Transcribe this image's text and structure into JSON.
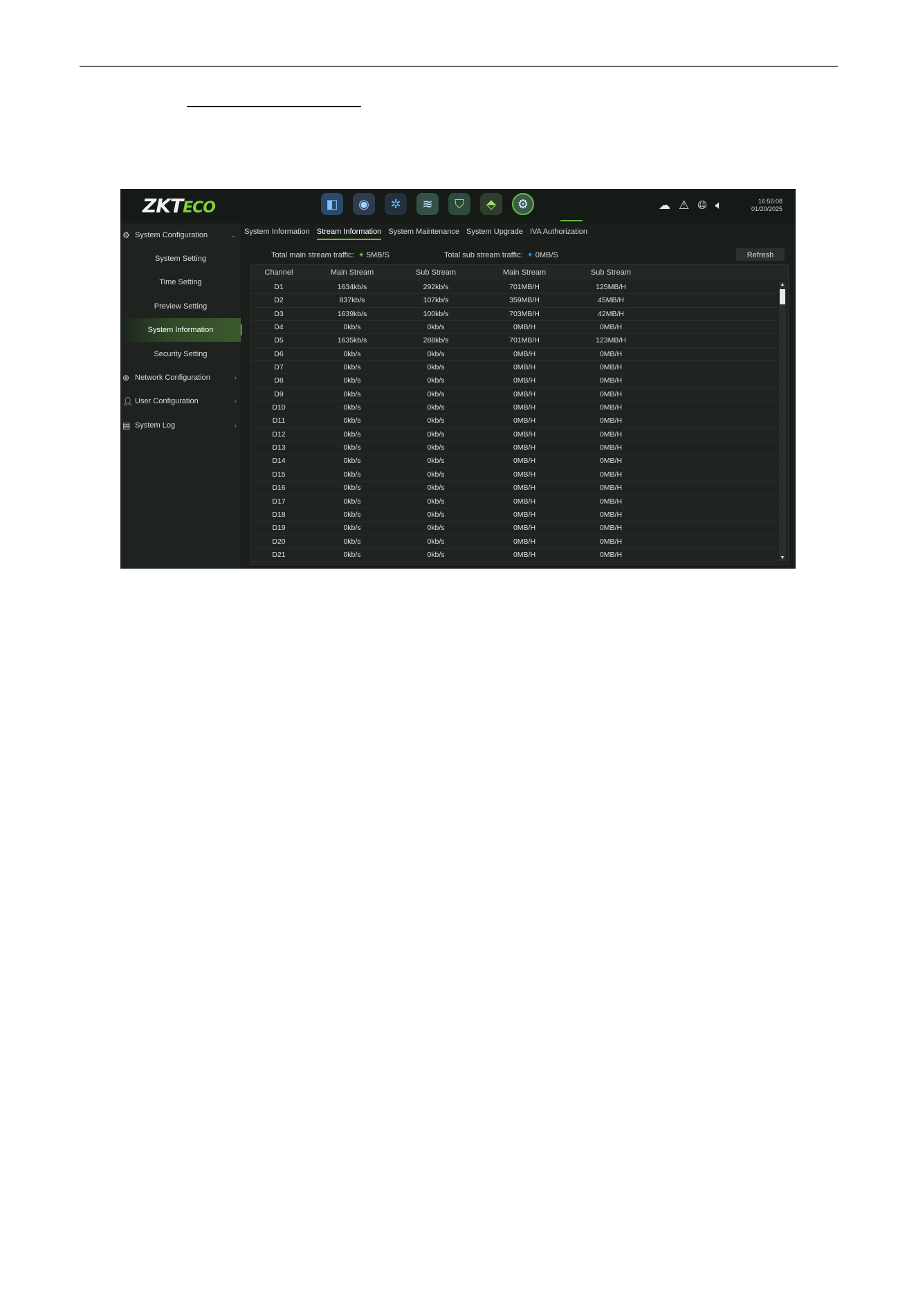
{
  "header": {
    "logo_main": "ZKT",
    "logo_eco": "ECO",
    "time": "16:56:08",
    "date": "01/20/2025"
  },
  "app_icons": [
    "camera-icon",
    "playback-icon",
    "network-icon",
    "storage-icon",
    "shield-icon",
    "alarm-box-icon",
    "settings-gear-icon"
  ],
  "status_icons": [
    "cloud-icon",
    "alarm-light-icon",
    "globe-icon",
    "speaker-icon"
  ],
  "sidebar": {
    "groups": [
      {
        "label": "System Configuration",
        "expanded": true
      },
      {
        "label": "Network Configuration"
      },
      {
        "label": "User Configuration"
      },
      {
        "label": "System Log"
      }
    ],
    "items": [
      {
        "label": "System Setting"
      },
      {
        "label": "Time Setting"
      },
      {
        "label": "Preview Setting"
      },
      {
        "label": "System Information",
        "active": true
      },
      {
        "label": "Security Setting"
      }
    ]
  },
  "tabs": [
    {
      "label": "System Information"
    },
    {
      "label": "Stream Information",
      "active": true
    },
    {
      "label": "System Maintenance"
    },
    {
      "label": "System Upgrade"
    },
    {
      "label": "IVA Authorization"
    }
  ],
  "traffic": {
    "main_label": "Total main stream traffic:",
    "main_value": "5MB/S",
    "sub_label": "Total sub stream traffic:",
    "sub_value": "0MB/S"
  },
  "refresh_label": "Refresh",
  "columns": [
    "Channel",
    "Main Stream",
    "Sub Stream",
    "Main Stream",
    "Sub Stream"
  ],
  "rows": [
    [
      "D1",
      "1634kb/s",
      "292kb/s",
      "701MB/H",
      "125MB/H"
    ],
    [
      "D2",
      "837kb/s",
      "107kb/s",
      "359MB/H",
      "45MB/H"
    ],
    [
      "D3",
      "1639kb/s",
      "100kb/s",
      "703MB/H",
      "42MB/H"
    ],
    [
      "D4",
      "0kb/s",
      "0kb/s",
      "0MB/H",
      "0MB/H"
    ],
    [
      "D5",
      "1635kb/s",
      "288kb/s",
      "701MB/H",
      "123MB/H"
    ],
    [
      "D6",
      "0kb/s",
      "0kb/s",
      "0MB/H",
      "0MB/H"
    ],
    [
      "D7",
      "0kb/s",
      "0kb/s",
      "0MB/H",
      "0MB/H"
    ],
    [
      "D8",
      "0kb/s",
      "0kb/s",
      "0MB/H",
      "0MB/H"
    ],
    [
      "D9",
      "0kb/s",
      "0kb/s",
      "0MB/H",
      "0MB/H"
    ],
    [
      "D10",
      "0kb/s",
      "0kb/s",
      "0MB/H",
      "0MB/H"
    ],
    [
      "D11",
      "0kb/s",
      "0kb/s",
      "0MB/H",
      "0MB/H"
    ],
    [
      "D12",
      "0kb/s",
      "0kb/s",
      "0MB/H",
      "0MB/H"
    ],
    [
      "D13",
      "0kb/s",
      "0kb/s",
      "0MB/H",
      "0MB/H"
    ],
    [
      "D14",
      "0kb/s",
      "0kb/s",
      "0MB/H",
      "0MB/H"
    ],
    [
      "D15",
      "0kb/s",
      "0kb/s",
      "0MB/H",
      "0MB/H"
    ],
    [
      "D16",
      "0kb/s",
      "0kb/s",
      "0MB/H",
      "0MB/H"
    ],
    [
      "D17",
      "0kb/s",
      "0kb/s",
      "0MB/H",
      "0MB/H"
    ],
    [
      "D18",
      "0kb/s",
      "0kb/s",
      "0MB/H",
      "0MB/H"
    ],
    [
      "D19",
      "0kb/s",
      "0kb/s",
      "0MB/H",
      "0MB/H"
    ],
    [
      "D20",
      "0kb/s",
      "0kb/s",
      "0MB/H",
      "0MB/H"
    ],
    [
      "D21",
      "0kb/s",
      "0kb/s",
      "0MB/H",
      "0MB/H"
    ]
  ],
  "colors": {
    "accent": "#5fbf3a",
    "background": "#1b1f1c",
    "main_traffic_icon": "#5fbf3a",
    "sub_traffic_icon": "#3a8fd6"
  }
}
